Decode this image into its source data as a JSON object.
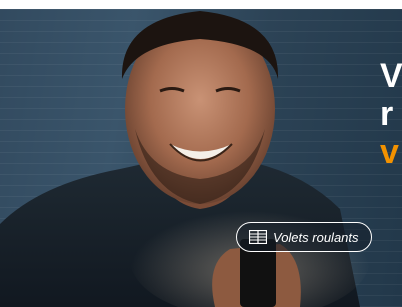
{
  "ad": {
    "headline_line1": "V",
    "headline_line2": "r",
    "headline_line3": "v",
    "headline_color": "#ffffff",
    "headline_accent_color": "#f39200",
    "tag": {
      "label": "Volets roulants",
      "icon": "window-blind-icon"
    }
  }
}
